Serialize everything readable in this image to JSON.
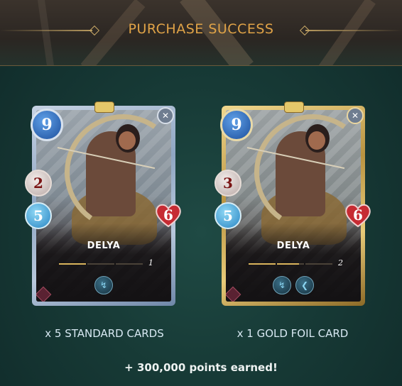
{
  "header": {
    "title": "PURCHASE SUCCESS"
  },
  "cards": {
    "standard": {
      "name": "DELYA",
      "mana": "9",
      "melee": "2",
      "speed": "5",
      "health": "6",
      "level": "1",
      "level_progress": 0.33,
      "abilities": [
        "lightning-arrow-icon"
      ]
    },
    "gold": {
      "name": "DELYA",
      "mana": "9",
      "melee": "3",
      "speed": "5",
      "health": "6",
      "level": "2",
      "level_progress": 0.6,
      "abilities": [
        "lightning-arrow-icon",
        "wind-wave-icon"
      ]
    }
  },
  "captions": {
    "standard": "x 5 STANDARD CARDS",
    "gold": "x 1 GOLD FOIL CARD"
  },
  "points": "+ 300,000 points earned!",
  "colors": {
    "title": "#e0a347",
    "background": "#173a36",
    "health": "#c62b33",
    "mana": "#1d4f9c"
  }
}
